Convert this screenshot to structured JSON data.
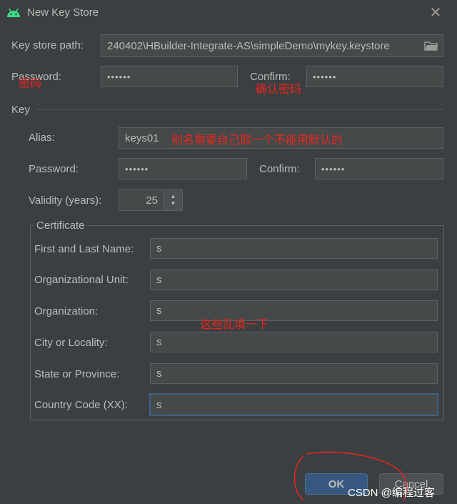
{
  "dialog": {
    "title": "New Key Store",
    "close_symbol": "✕"
  },
  "keystore": {
    "path_label": "Key store path:",
    "path_value": "240402\\HBuilder-Integrate-AS\\simpleDemo\\mykey.keystore",
    "password_label": "Password:",
    "password_value": "••••••",
    "confirm_label": "Confirm:",
    "confirm_value": "••••••"
  },
  "key": {
    "section_label": "Key",
    "alias_label": "Alias:",
    "alias_value": "keys01",
    "password_label": "Password:",
    "password_value": "••••••",
    "confirm_label": "Confirm:",
    "confirm_value": "••••••",
    "validity_label": "Validity (years):",
    "validity_value": "25"
  },
  "certificate": {
    "legend": "Certificate",
    "fields": [
      {
        "label": "First and Last Name:",
        "value": "s"
      },
      {
        "label": "Organizational Unit:",
        "value": "s"
      },
      {
        "label": "Organization:",
        "value": "s"
      },
      {
        "label": "City or Locality:",
        "value": "s"
      },
      {
        "label": "State or Province:",
        "value": "s"
      },
      {
        "label": "Country Code (XX):",
        "value": "s"
      }
    ]
  },
  "annotations": {
    "password": "密码",
    "confirm": "确认密码",
    "alias": "别名需要自己取一个不能用默认的",
    "certificate": "这些乱填一下"
  },
  "buttons": {
    "ok": "OK",
    "cancel": "Cancel"
  },
  "watermark": "CSDN @编程过客",
  "colors": {
    "background": "#3c3f41",
    "field": "#45494a",
    "annotation": "#e8261c",
    "ok_button": "#365880"
  }
}
